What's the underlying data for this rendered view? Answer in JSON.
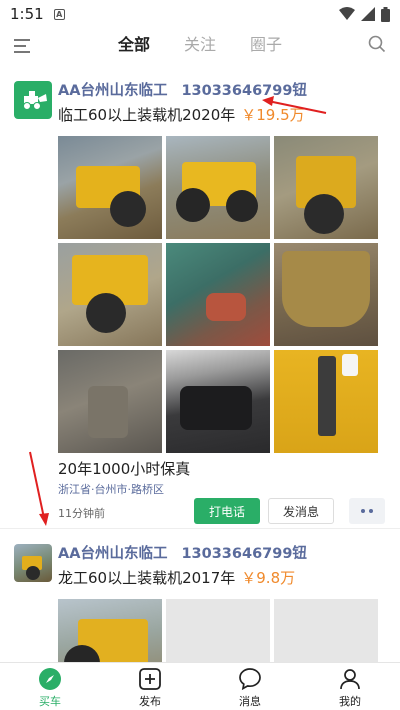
{
  "status_bar": {
    "time": "1:51",
    "notification_glyph": "A",
    "icons": [
      "wifi-icon",
      "signal-icon",
      "battery-icon"
    ]
  },
  "top_nav": {
    "tabs": [
      {
        "label": "全部",
        "active": true
      },
      {
        "label": "关注",
        "active": false
      },
      {
        "label": "圈子",
        "active": false
      }
    ]
  },
  "posts": [
    {
      "author": "AA台州山东临工",
      "phone": "13033646799钮",
      "title": "临工60以上装载机2020年",
      "price": "￥19.5万",
      "description": "20年1000小时保真",
      "location": "浙江省·台州市·路桥区",
      "time_ago": "11分钟前",
      "call_label": "打电话",
      "message_label": "发消息"
    },
    {
      "author": "AA台州山东临工",
      "phone": "13033646799钮",
      "title": "龙工60以上装载机2017年",
      "price": "￥9.8万"
    }
  ],
  "bottom_nav": [
    {
      "label": "买车",
      "icon": "compass-icon",
      "active": true
    },
    {
      "label": "发布",
      "icon": "plus-square-icon",
      "active": false
    },
    {
      "label": "消息",
      "icon": "chat-bubble-icon",
      "active": false
    },
    {
      "label": "我的",
      "icon": "person-icon",
      "active": false
    }
  ],
  "colors": {
    "accent_green": "#2aae67",
    "author_blue": "#5a6b9c",
    "price_orange": "#f08a2c",
    "annotation_red": "#e02020"
  }
}
